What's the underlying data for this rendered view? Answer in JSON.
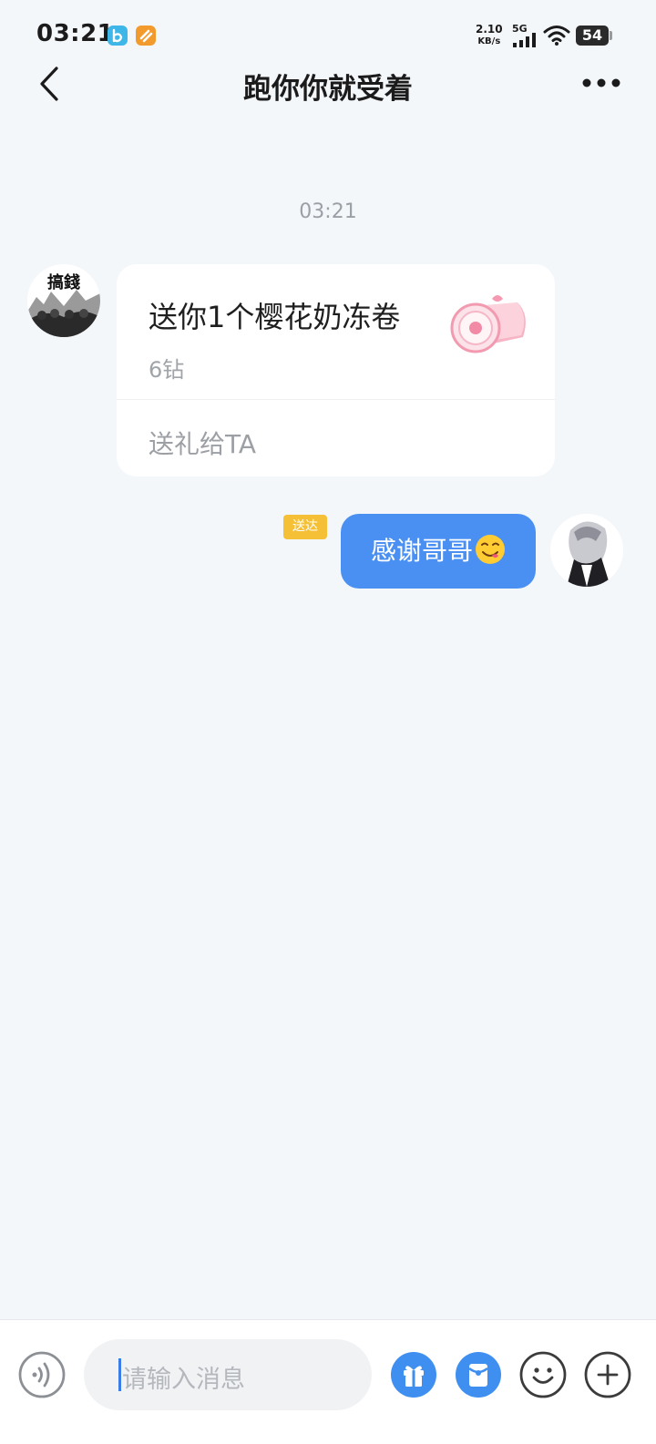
{
  "status_bar": {
    "time": "03:21",
    "net_speed_value": "2.10",
    "net_speed_unit": "KB/s",
    "network": "5G",
    "battery": "54",
    "app_icons": [
      "app-icon-blue",
      "app-icon-orange"
    ]
  },
  "header": {
    "title": "跑你你就受着",
    "back_icon": "chevron-left-icon",
    "more_icon": "more-horizontal-icon"
  },
  "chat": {
    "timestamp": "03:21",
    "messages": [
      {
        "side": "left",
        "type": "gift",
        "avatar_text": "搞錢",
        "gift_title": "送你1个樱花奶冻卷",
        "gift_price": "6钻",
        "gift_action": "送礼给TA"
      },
      {
        "side": "right",
        "type": "text",
        "status": "送达",
        "text": "感谢哥哥",
        "emoji": "yum-face-emoji"
      }
    ]
  },
  "input_bar": {
    "placeholder": "请输入消息",
    "buttons": [
      "voice-icon",
      "gift-icon",
      "red-packet-icon",
      "emoji-icon",
      "plus-icon"
    ]
  },
  "colors": {
    "background": "#f4f7fa",
    "bubble": "#4a90f3",
    "badge": "#f5c035",
    "action_blue": "#3f8ff1"
  }
}
